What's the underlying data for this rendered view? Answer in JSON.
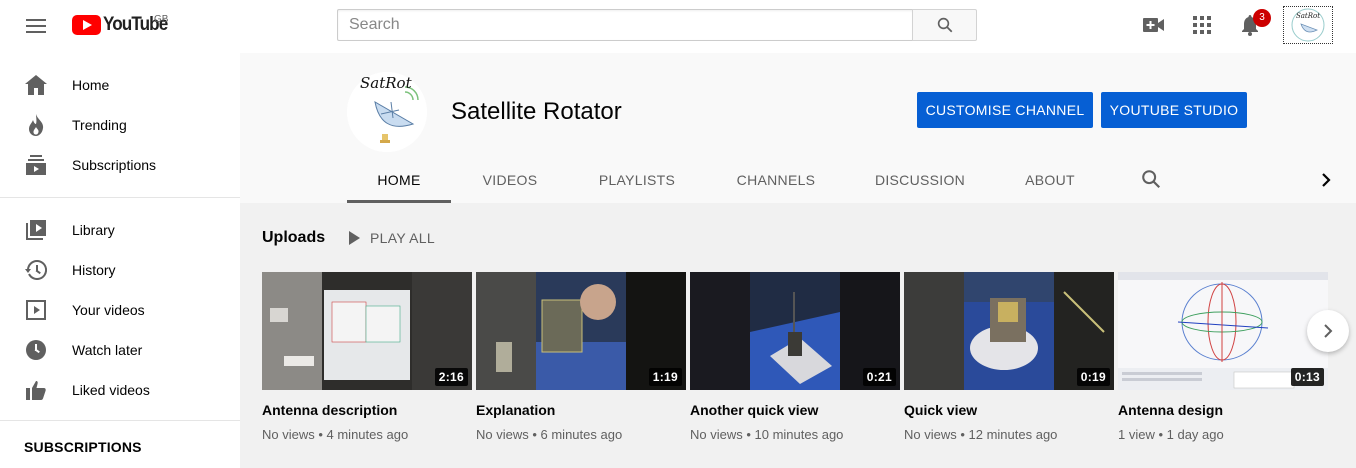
{
  "masthead": {
    "logo_text": "YouTube",
    "region": "GB",
    "search_placeholder": "Search",
    "notification_count": "3",
    "avatar_label": "SatRot"
  },
  "sidebar": {
    "items": [
      {
        "label": "Home",
        "icon": "home-icon"
      },
      {
        "label": "Trending",
        "icon": "trending-icon"
      },
      {
        "label": "Subscriptions",
        "icon": "subscriptions-icon"
      },
      {
        "label": "Library",
        "icon": "library-icon"
      },
      {
        "label": "History",
        "icon": "history-icon"
      },
      {
        "label": "Your videos",
        "icon": "your-videos-icon"
      },
      {
        "label": "Watch later",
        "icon": "watch-later-icon"
      },
      {
        "label": "Liked videos",
        "icon": "liked-videos-icon"
      }
    ],
    "subscriptions_heading": "SUBSCRIPTIONS"
  },
  "channel": {
    "avatar_label": "SatRot",
    "name": "Satellite Rotator",
    "customise_label": "CUSTOMISE CHANNEL",
    "studio_label": "YOUTUBE STUDIO",
    "tabs": [
      "HOME",
      "VIDEOS",
      "PLAYLISTS",
      "CHANNELS",
      "DISCUSSION",
      "ABOUT"
    ],
    "active_tab": "HOME"
  },
  "uploads": {
    "title": "Uploads",
    "play_all_label": "PLAY ALL",
    "videos": [
      {
        "title": "Antenna description",
        "duration": "2:16",
        "meta": "No views • 4 minutes ago"
      },
      {
        "title": "Explanation",
        "duration": "1:19",
        "meta": "No views • 6 minutes ago"
      },
      {
        "title": "Another quick view",
        "duration": "0:21",
        "meta": "No views • 10 minutes ago"
      },
      {
        "title": "Quick view",
        "duration": "0:19",
        "meta": "No views • 12 minutes ago"
      },
      {
        "title": "Antenna design",
        "duration": "0:13",
        "meta": "1 view • 1 day ago"
      }
    ]
  },
  "colors": {
    "brand_red": "#ff0000",
    "button_blue": "#065fd4",
    "badge_red": "#cc0000"
  }
}
